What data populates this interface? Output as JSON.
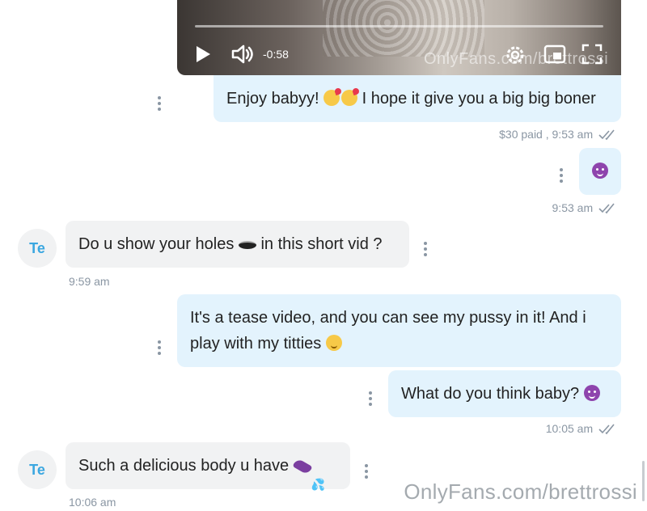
{
  "video": {
    "time": "-0:58",
    "watermark": "OnlyFans.com/brettrossi",
    "play_icon": "play-icon",
    "volume_icon": "volume-icon",
    "settings_icon": "gear-icon",
    "pip_icon": "picture-in-picture-icon",
    "fullscreen_icon": "fullscreen-icon"
  },
  "messages": [
    {
      "side": "out",
      "text_a": "Enjoy babyy!",
      "text_b": "I hope it give you a big big boner",
      "meta_paid": "$30 paid ,",
      "meta_time": "9:53 am"
    },
    {
      "side": "out",
      "emoji": "smiling-devil",
      "meta_time": "9:53 am"
    },
    {
      "side": "in",
      "avatar": "Te",
      "text_a": "Do u show your holes",
      "text_b": "in this short vid ?",
      "meta_time": "9:59 am"
    },
    {
      "side": "out",
      "line1": "It's a tease video, and you can see my pussy in it! And i",
      "line2": "play with my titties",
      "meta_time": ""
    },
    {
      "side": "out",
      "text_a": "What do you think baby?",
      "meta_time": "10:05 am"
    },
    {
      "side": "in",
      "avatar": "Te",
      "text_a": "Such a delicious body u have",
      "meta_time": "10:06 am"
    }
  ],
  "watermark": "OnlyFans.com/brettrossi",
  "colors": {
    "outgoing_bubble": "#e3f3fd",
    "incoming_bubble": "#f1f2f3",
    "accent": "#3ba7e0",
    "meta": "#8a96a3"
  }
}
